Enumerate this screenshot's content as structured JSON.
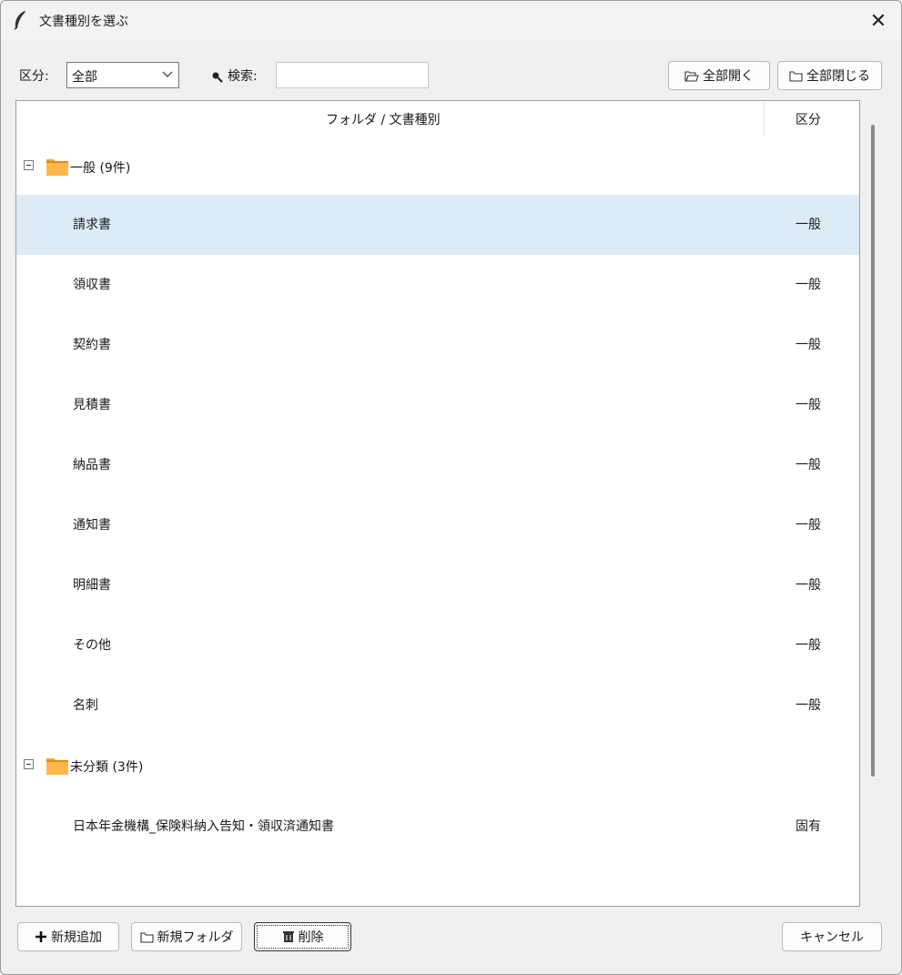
{
  "window": {
    "title": "文書種別を選ぶ",
    "close_label": "✕"
  },
  "toolbar": {
    "category_label": "区分:",
    "category_value": "全部",
    "search_label": "検索:",
    "search_value": "",
    "expand_all_label": "全部開く",
    "collapse_all_label": "全部閉じる"
  },
  "tree": {
    "columns": [
      "フォルダ / 文書種別",
      "区分"
    ],
    "folders": [
      {
        "label": "一般 (9件)",
        "items": [
          {
            "name": "請求書",
            "category": "一般",
            "selected": true
          },
          {
            "name": "領収書",
            "category": "一般"
          },
          {
            "name": "契約書",
            "category": "一般"
          },
          {
            "name": "見積書",
            "category": "一般"
          },
          {
            "name": "納品書",
            "category": "一般"
          },
          {
            "name": "通知書",
            "category": "一般"
          },
          {
            "name": "明細書",
            "category": "一般"
          },
          {
            "name": "その他",
            "category": "一般"
          },
          {
            "name": "名刺",
            "category": "一般"
          }
        ]
      },
      {
        "label": "未分類 (3件)",
        "items": [
          {
            "name": "日本年金機構_保険料納入告知・領収済通知書",
            "category": "固有"
          }
        ]
      }
    ]
  },
  "footer": {
    "add_label": "新規追加",
    "new_folder_label": "新規フォルダ",
    "delete_label": "削除",
    "cancel_label": "キャンセル"
  },
  "colors": {
    "selection": "#ddebf7",
    "folder": "#f5a623"
  }
}
